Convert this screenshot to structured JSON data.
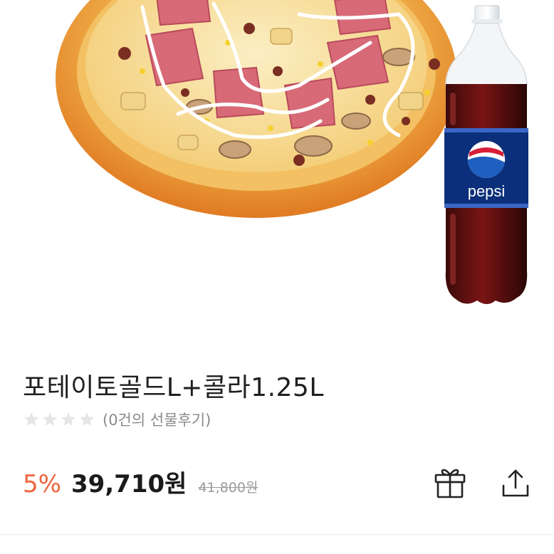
{
  "product": {
    "image_icon": "pizza-and-cola-image",
    "bottle_brand": "pepsi",
    "title": "포테이토골드L+콜라1.25L",
    "rating": 0,
    "rating_max": 5,
    "review_text": "(0건의 선물후기)",
    "discount": "5%",
    "price": "39,710원",
    "original_price": "41,800원"
  },
  "actions": {
    "gift_icon": "gift-icon",
    "share_icon": "share-icon"
  },
  "colors": {
    "discount": "#f0643c",
    "star_empty": "#e6e6e6",
    "text": "#1f1f1f",
    "muted": "#8a8a8a"
  }
}
